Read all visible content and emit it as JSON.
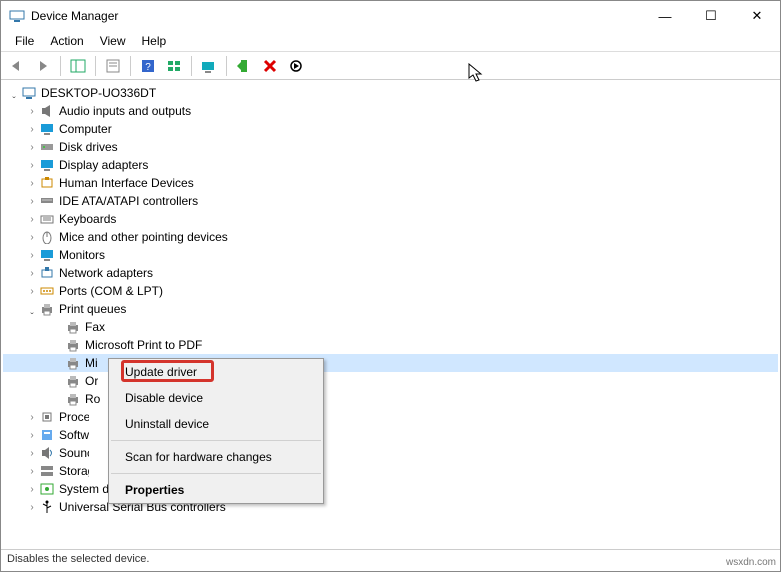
{
  "window": {
    "title": "Device Manager",
    "min": "—",
    "max": "☐",
    "close": "✕"
  },
  "menubar": [
    "File",
    "Action",
    "View",
    "Help"
  ],
  "tree": {
    "root": "DESKTOP-UO336DT",
    "categories": [
      {
        "label": "Audio inputs and outputs",
        "icon": "speaker"
      },
      {
        "label": "Computer",
        "icon": "monitor"
      },
      {
        "label": "Disk drives",
        "icon": "disk"
      },
      {
        "label": "Display adapters",
        "icon": "monitor"
      },
      {
        "label": "Human Interface Devices",
        "icon": "hid"
      },
      {
        "label": "IDE ATA/ATAPI controllers",
        "icon": "ide"
      },
      {
        "label": "Keyboards",
        "icon": "keyboard"
      },
      {
        "label": "Mice and other pointing devices",
        "icon": "mouse"
      },
      {
        "label": "Monitors",
        "icon": "monitor"
      },
      {
        "label": "Network adapters",
        "icon": "network"
      },
      {
        "label": "Ports (COM & LPT)",
        "icon": "port"
      },
      {
        "label": "Print queues",
        "icon": "printer",
        "expanded": true
      },
      {
        "label": "Proces",
        "icon": "cpu",
        "clip": true
      },
      {
        "label": "Softwa",
        "icon": "sw",
        "clip": true
      },
      {
        "label": "Sounc",
        "icon": "sound",
        "clip": true
      },
      {
        "label": "Storag",
        "icon": "storage",
        "clip": true
      },
      {
        "label": "System devices",
        "icon": "system"
      },
      {
        "label": "Universal Serial Bus controllers",
        "icon": "usb"
      }
    ],
    "print_children": [
      {
        "label": "Fax"
      },
      {
        "label": "Microsoft Print to PDF"
      },
      {
        "label": "Mi",
        "sel": true,
        "clip": true
      },
      {
        "label": "Or",
        "clip": true
      },
      {
        "label": "Ro",
        "clip": true
      }
    ]
  },
  "context": {
    "update": "Update driver",
    "disable": "Disable device",
    "uninstall": "Uninstall device",
    "scan": "Scan for hardware changes",
    "properties": "Properties"
  },
  "status": "Disables the selected device.",
  "watermark": "wsxdn.com"
}
